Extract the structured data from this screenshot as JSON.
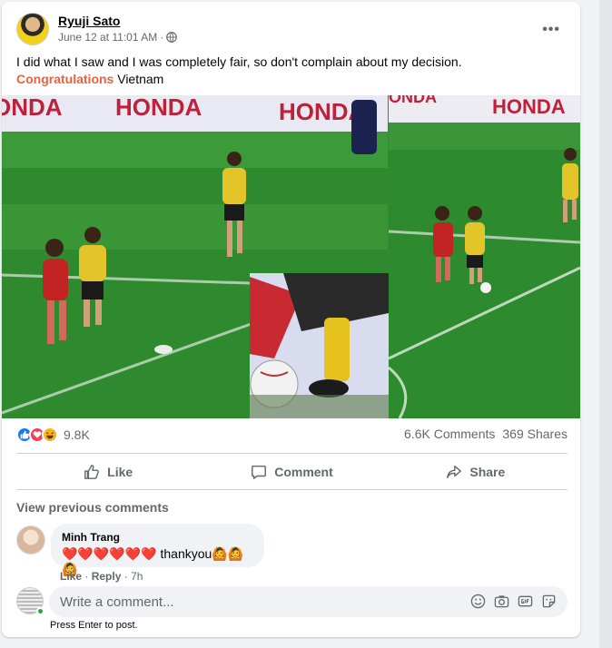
{
  "post": {
    "author": "Ryuji Sato",
    "date": "June 12 at 11:01 AM",
    "separator": "·",
    "text_line1": "I did what I saw and I was completely fair, so don't complain about my decision.",
    "text_highlight": "Congratulations",
    "text_rest": " Vietnam",
    "more_icon": "•••"
  },
  "media": {
    "banner_left": "ONDA",
    "banner_mid": "HONDA",
    "banner_mid2": "HONDA",
    "banner_right1": "ONDA",
    "banner_right2": "HONDA"
  },
  "stats": {
    "reaction_count": "9.8K",
    "comments": "6.6K Comments",
    "shares": "369 Shares"
  },
  "actions": {
    "like": "Like",
    "comment": "Comment",
    "share": "Share"
  },
  "comments": {
    "view_previous": "View previous comments",
    "items": [
      {
        "name": "Minh Trang",
        "text": "❤️❤️❤️❤️❤️❤️ thankyou🙆🙆🙆",
        "like": "Like",
        "dot": "·",
        "reply": "Reply",
        "time": "7h"
      }
    ]
  },
  "composer": {
    "placeholder": "Write a comment...",
    "hint": "Press Enter to post."
  },
  "colors": {
    "accent": "#1877f2",
    "highlight": "#f0603c",
    "pitch": "#3a8a2a"
  }
}
